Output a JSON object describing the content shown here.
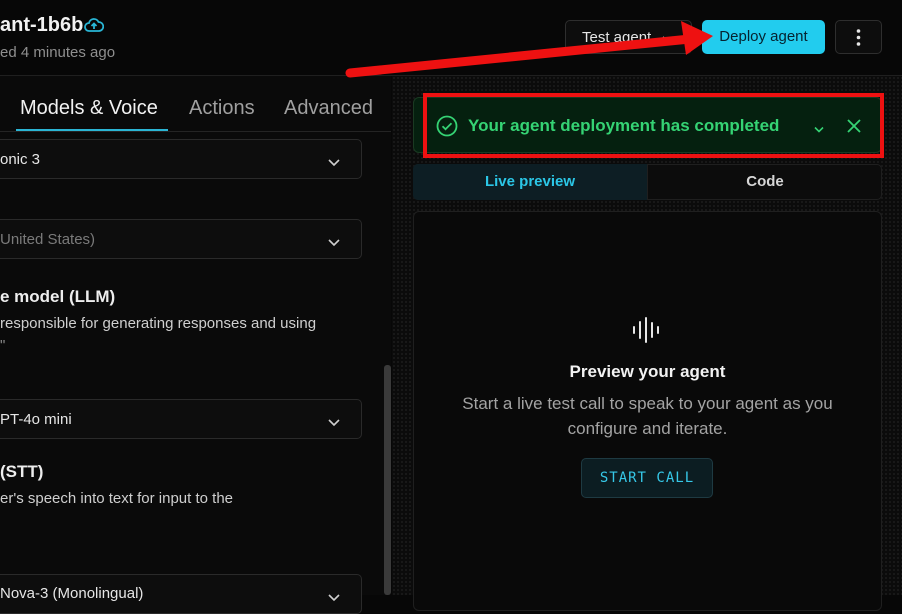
{
  "header": {
    "agent_name": "ant-1b6b",
    "saved_text": "ed 4 minutes ago",
    "test_agent_label": "Test agent",
    "deploy_label": "Deploy agent",
    "cloud_icon": "cloud-upload-icon",
    "more_icon": "vertical-dots-icon"
  },
  "tabs": [
    {
      "label": "Models & Voice",
      "active": true
    },
    {
      "label": "Actions",
      "active": false
    },
    {
      "label": "Advanced",
      "active": false
    }
  ],
  "left": {
    "voice_select": "onic 3",
    "language_select": "United States)",
    "llm_title": "e model (LLM)",
    "llm_desc_1": "responsible for generating responses and using",
    "llm_desc_2": "\"",
    "llm_select": "PT-4o mini",
    "stt_title": "(STT)",
    "stt_desc_1": "er's speech into text for input to the",
    "stt_desc_2": "",
    "stt_select": "Nova-3 (Monolingual)"
  },
  "toast": {
    "message": "Your agent deployment has completed",
    "icon": "check-circle-icon",
    "color": "#35d374"
  },
  "view_tabs": {
    "live_preview": "Live preview",
    "code": "Code"
  },
  "preview": {
    "icon": "audio-waveform-icon",
    "title": "Preview your agent",
    "description": "Start a live test call to speak to your agent as you configure and iterate.",
    "button": "START CALL"
  },
  "colors": {
    "accent": "#22ccee",
    "success": "#35d374",
    "annotation": "#ee1111"
  }
}
